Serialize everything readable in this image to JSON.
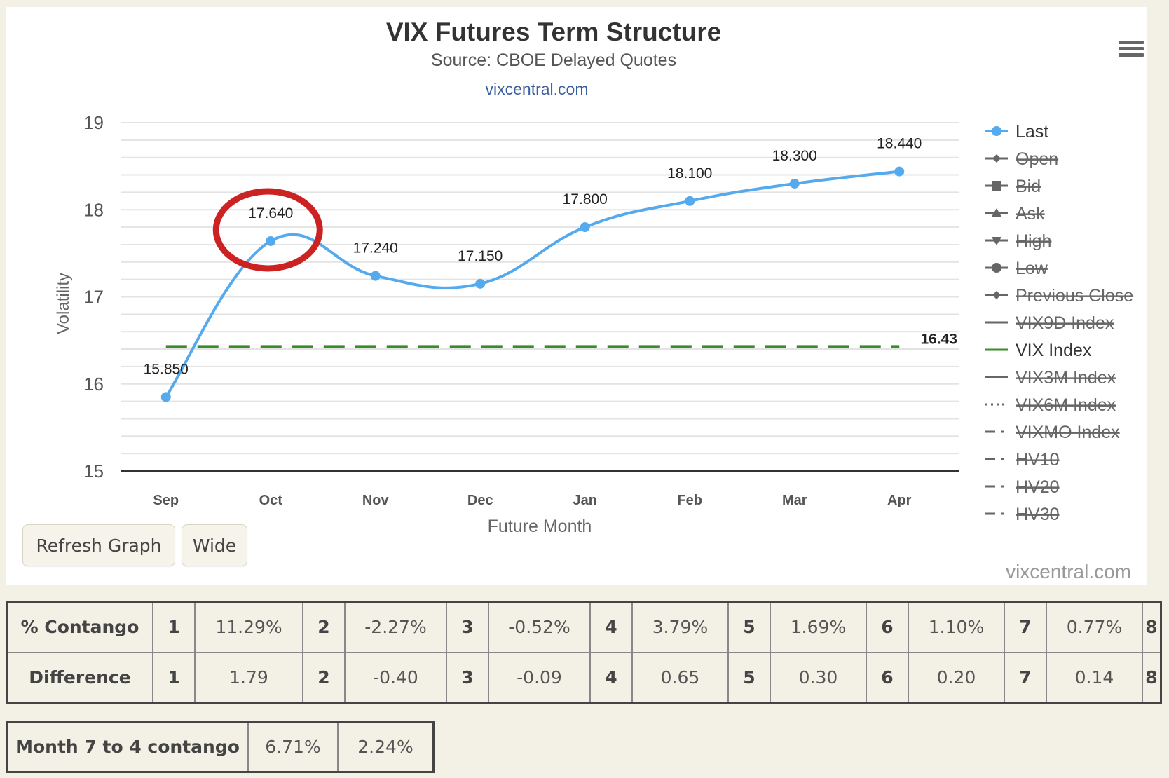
{
  "chart_data": {
    "type": "line",
    "title": "VIX Futures Term Structure",
    "subtitle": "Source: CBOE Delayed Quotes",
    "credit_top": "vixcentral.com",
    "xlabel": "Future Month",
    "ylabel": "Volatility",
    "categories": [
      "Sep",
      "Oct",
      "Nov",
      "Dec",
      "Jan",
      "Feb",
      "Mar",
      "Apr"
    ],
    "ylim": [
      15,
      19
    ],
    "yticks": [
      15,
      16,
      17,
      18,
      19
    ],
    "grid": true,
    "series": [
      {
        "name": "Last",
        "color": "#55aaee",
        "values": [
          15.85,
          17.64,
          17.24,
          17.15,
          17.8,
          18.1,
          18.3,
          18.44
        ],
        "labels": [
          "15.850",
          "17.640",
          "17.240",
          "17.150",
          "17.800",
          "18.100",
          "18.300",
          "18.440"
        ],
        "smooth": true,
        "markers": true
      },
      {
        "name": "VIX Index",
        "color": "#3a8c2a",
        "values": [
          16.43,
          16.43,
          16.43,
          16.43,
          16.43,
          16.43,
          16.43,
          16.43
        ],
        "end_label": "16.43",
        "dashed": true
      }
    ],
    "annotation": {
      "type": "circle",
      "target": "Oct",
      "color": "#cc2222"
    },
    "legend_position": "right",
    "legend": [
      {
        "label": "Last",
        "symbol": "circle",
        "active": true,
        "color": "#55aaee"
      },
      {
        "label": "Open",
        "symbol": "diamond",
        "active": false
      },
      {
        "label": "Bid",
        "symbol": "square",
        "active": false
      },
      {
        "label": "Ask",
        "symbol": "triangle",
        "active": false
      },
      {
        "label": "High",
        "symbol": "triangle-down",
        "active": false
      },
      {
        "label": "Low",
        "symbol": "circle",
        "active": false
      },
      {
        "label": "Previous Close",
        "symbol": "diamond",
        "active": false
      },
      {
        "label": "VIX9D Index",
        "symbol": "line",
        "active": false
      },
      {
        "label": "VIX Index",
        "symbol": "line",
        "active": true,
        "color": "#3a8c2a"
      },
      {
        "label": "VIX3M Index",
        "symbol": "line",
        "active": false
      },
      {
        "label": "VIX6M Index",
        "symbol": "dotted",
        "active": false
      },
      {
        "label": "VIXMO Index",
        "symbol": "dashdot",
        "active": false
      },
      {
        "label": "HV10",
        "symbol": "dashdot",
        "active": false
      },
      {
        "label": "HV20",
        "symbol": "dashdot",
        "active": false
      },
      {
        "label": "HV30",
        "symbol": "dashdot",
        "active": false
      }
    ]
  },
  "controls": {
    "refresh_label": "Refresh Graph",
    "wide_label": "Wide",
    "menu_icon": "hamburger-menu-icon"
  },
  "credit_bottom": "vixcentral.com",
  "contango_table": {
    "rows": [
      {
        "label": "% Contango",
        "cells": [
          {
            "idx": "1",
            "val": "11.29%"
          },
          {
            "idx": "2",
            "val": "-2.27%"
          },
          {
            "idx": "3",
            "val": "-0.52%"
          },
          {
            "idx": "4",
            "val": "3.79%"
          },
          {
            "idx": "5",
            "val": "1.69%"
          },
          {
            "idx": "6",
            "val": "1.10%"
          },
          {
            "idx": "7",
            "val": "0.77%"
          }
        ],
        "last_idx": "8"
      },
      {
        "label": "Difference",
        "cells": [
          {
            "idx": "1",
            "val": "1.79"
          },
          {
            "idx": "2",
            "val": "-0.40"
          },
          {
            "idx": "3",
            "val": "-0.09"
          },
          {
            "idx": "4",
            "val": "0.65"
          },
          {
            "idx": "5",
            "val": "0.30"
          },
          {
            "idx": "6",
            "val": "0.20"
          },
          {
            "idx": "7",
            "val": "0.14"
          }
        ],
        "last_idx": "8"
      }
    ]
  },
  "month74_table": {
    "label": "Month 7 to 4 contango",
    "values": [
      "6.71%",
      "2.24%"
    ]
  }
}
